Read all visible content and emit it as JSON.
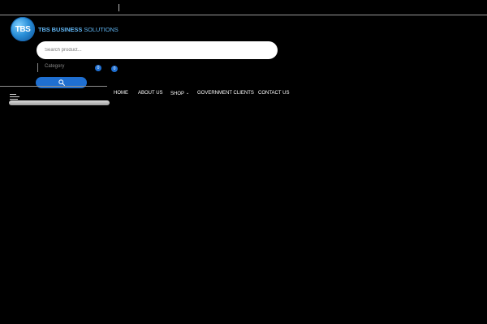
{
  "logo": {
    "badge_text": "TBS",
    "text_bold": "TBS BUSINESS",
    "text_rest": "SOLUTIONS",
    "brand_color": "#5fb3f0"
  },
  "search": {
    "placeholder": "Search product...",
    "category_label": "Category",
    "button_icon": "search-icon",
    "accent_color": "#1f6fd1"
  },
  "counters": {
    "wishlist_count": "0",
    "cart_count": "0"
  },
  "nav": {
    "items": [
      {
        "label": "HOME"
      },
      {
        "label": "ABOUT US"
      },
      {
        "label": "SHOP",
        "has_dropdown": true
      },
      {
        "label": "GOVERNMENT CLIENTS"
      },
      {
        "label": "CONTACT US"
      }
    ],
    "shop_dropdown_icon": "chevron-down-icon"
  },
  "mobile_menu_icon": "hamburger-icon"
}
